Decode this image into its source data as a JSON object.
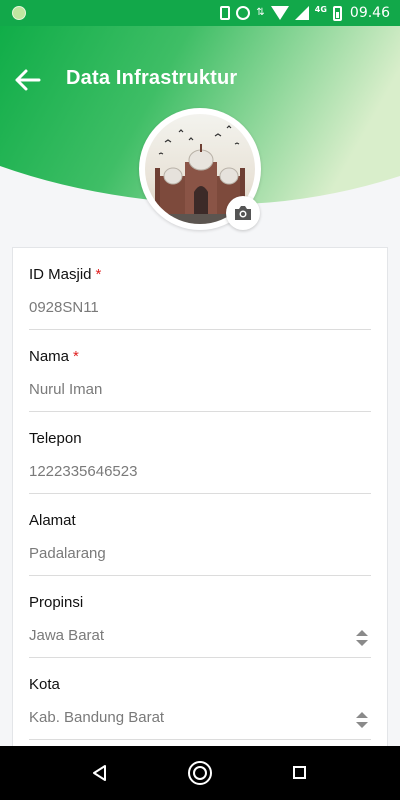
{
  "status_bar": {
    "time": "09.46",
    "network_label": "4G",
    "icons": [
      "notification-dot-icon",
      "vibrate-icon",
      "alarm-icon",
      "data-arrows-icon",
      "wifi-icon",
      "signal-icon",
      "battery-icon"
    ]
  },
  "header": {
    "title": "Data Infrastruktur",
    "back_icon": "arrow-left-icon",
    "gradient_colors": [
      "#10ad48",
      "#d9eecb"
    ]
  },
  "avatar": {
    "camera_icon": "camera-icon"
  },
  "form": {
    "fields": [
      {
        "label": "ID Masjid",
        "required_mark": "*",
        "value": "0928SN11"
      },
      {
        "label": "Nama",
        "required_mark": "*",
        "value": "Nurul Iman"
      },
      {
        "label": "Telepon",
        "required_mark": "",
        "value": "1222335646523"
      },
      {
        "label": "Alamat",
        "required_mark": "",
        "value": "Padalarang"
      },
      {
        "label": "Propinsi",
        "required_mark": "",
        "value": "Jawa Barat",
        "type": "select"
      },
      {
        "label": "Kota",
        "required_mark": "",
        "value": "Kab. Bandung Barat",
        "type": "select"
      }
    ]
  },
  "nav_bar": {
    "icons": [
      "nav-back-icon",
      "nav-home-icon",
      "nav-recents-icon"
    ]
  }
}
